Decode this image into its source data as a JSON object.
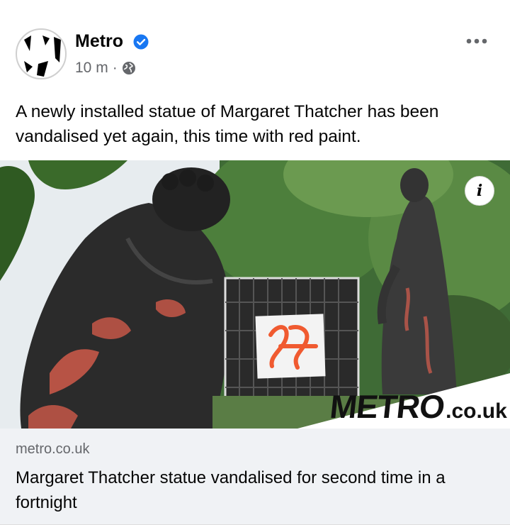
{
  "post": {
    "page_name": "Metro",
    "verified": true,
    "timestamp": "10 m",
    "separator": "·",
    "audience_icon": "globe-icon",
    "text": "A newly installed statue of Margaret Thatcher has been vandalised yet again, this time with red paint."
  },
  "link_preview": {
    "domain": "metro.co.uk",
    "title": "Margaret Thatcher statue vandalised for second time in a fortnight",
    "image": {
      "watermark_main": "METRO",
      "watermark_tld": ".co.uk",
      "info_label": "i"
    }
  },
  "colors": {
    "verified_badge": "#1877f2",
    "secondary_text": "#65676b",
    "footer_bg": "#f0f2f5",
    "paint_red": "#e0442c"
  }
}
